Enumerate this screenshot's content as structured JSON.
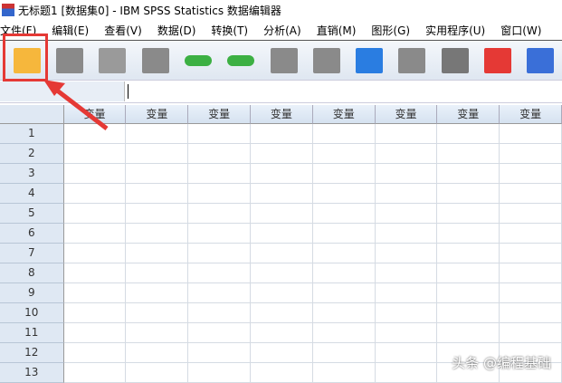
{
  "window": {
    "title": "无标题1 [数据集0] - IBM SPSS Statistics 数据编辑器"
  },
  "menu": [
    "文件(F)",
    "编辑(E)",
    "查看(V)",
    "数据(D)",
    "转换(T)",
    "分析(A)",
    "直销(M)",
    "图形(G)",
    "实用程序(U)",
    "窗口(W)"
  ],
  "toolbar": [
    {
      "name": "open-folder-icon",
      "color": "#f6b73c"
    },
    {
      "name": "save-icon",
      "color": "#8a8a8a"
    },
    {
      "name": "print-icon",
      "color": "#9a9a9a"
    },
    {
      "name": "dialog-recall-icon",
      "color": "#8a8a8a"
    },
    {
      "name": "undo-icon",
      "color": "#3cb043"
    },
    {
      "name": "redo-icon",
      "color": "#3cb043"
    },
    {
      "name": "goto-case-icon",
      "color": "#8a8a8a"
    },
    {
      "name": "goto-variable-icon",
      "color": "#8a8a8a"
    },
    {
      "name": "variables-icon",
      "color": "#2a7de1"
    },
    {
      "name": "run-descriptives-icon",
      "color": "#8a8a8a"
    },
    {
      "name": "find-icon",
      "color": "#777777"
    },
    {
      "name": "insert-cases-icon",
      "color": "#e53935"
    },
    {
      "name": "insert-variable-icon",
      "color": "#3a6fd8"
    }
  ],
  "grid": {
    "column_header": "变量",
    "columns": 8,
    "rows": [
      "1",
      "2",
      "3",
      "4",
      "5",
      "6",
      "7",
      "8",
      "9",
      "10",
      "11",
      "12",
      "13"
    ]
  },
  "watermark": "头条 @编程基础",
  "highlight_color": "#e53935"
}
